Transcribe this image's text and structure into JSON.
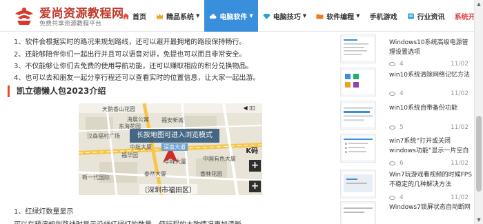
{
  "site": {
    "name": "爱尚资源教程网",
    "slogan": "免费共享资源教程平台"
  },
  "nav": {
    "items": [
      {
        "label": "首页",
        "icon": "home-icon",
        "dropdown": false,
        "active": false
      },
      {
        "label": "精品系统",
        "icon": "crown-icon",
        "dropdown": true,
        "active": false
      },
      {
        "label": "电脑软件",
        "icon": "cloud-icon",
        "dropdown": true,
        "active": true
      },
      {
        "label": "电脑技巧",
        "icon": "diamond-icon",
        "dropdown": true,
        "active": false
      },
      {
        "label": "软件编程",
        "icon": "folder-icon",
        "dropdown": true,
        "active": false
      },
      {
        "label": "手机游戏",
        "icon": "",
        "dropdown": false,
        "active": false
      },
      {
        "label": "行业资讯",
        "icon": "news-icon",
        "dropdown": false,
        "active": false
      },
      {
        "label": "系统开号",
        "icon": "",
        "dropdown": false,
        "active": false
      }
    ]
  },
  "article": {
    "features": [
      "1、软件会根据实时的路况来规划路线，还可以避开最拥堵的路段保持畅行。",
      "2、还能够陪伴你们一起出行并且可以语音对讲，免提也可以而且非常安全。",
      "3、不仅能够让你们去免费的使用导航功能，还可以赚取相应的积分兑换物品。",
      "4、也可以去和朋友一起分享行程还可以查看实时的位置信息，让大家一起出游。"
    ],
    "section_title": "凯立德懒人包2023介绍",
    "map": {
      "tip": "长按地图可进入浏览模式",
      "city": "〔深圳市福田区〕",
      "k_label": "K码",
      "zoom_in": "+",
      "labels": [
        "天鹅香山花园",
        "海晨公寓",
        "东海花园",
        "福安新城",
        "汉森福村广场",
        "中航大厦",
        "深南大道",
        "福华园",
        "中国有色大厦",
        "泰然大厦",
        "香林花园",
        "新一代国际",
        "华峰大厦"
      ]
    },
    "after_heading": "1、红绿灯数量显示",
    "after_text": "可以在预演规划路线时显示沿线红绿灯的数量，使行程的大致情况更加清晰。"
  },
  "sidebar": {
    "items": [
      {
        "title": "Windows10系统高级电源管理设置选项",
        "views": "4",
        "date": "11/02"
      },
      {
        "title": "win10系统清除网络记忆方法",
        "views": "4",
        "date": "11/02"
      },
      {
        "title": "win10系统自带备份功能",
        "views": "5",
        "date": "11/02"
      },
      {
        "title": "win7系统“打开或关闭windows功能”显示一片空白",
        "views": "6",
        "date": "11/02"
      },
      {
        "title": "Win7玩游戏看视频的时候FPS不稳定的几种解决方法",
        "views": "4",
        "date": "11/02"
      },
      {
        "title": "Windows7锁屏状态自动断网",
        "views": "",
        "date": ""
      }
    ]
  },
  "colors": {
    "brand_red": "#c0392b",
    "nav_active": "#3a8fdc",
    "section_accent": "#e04a2f",
    "highlight_red": "#e03a3a"
  }
}
